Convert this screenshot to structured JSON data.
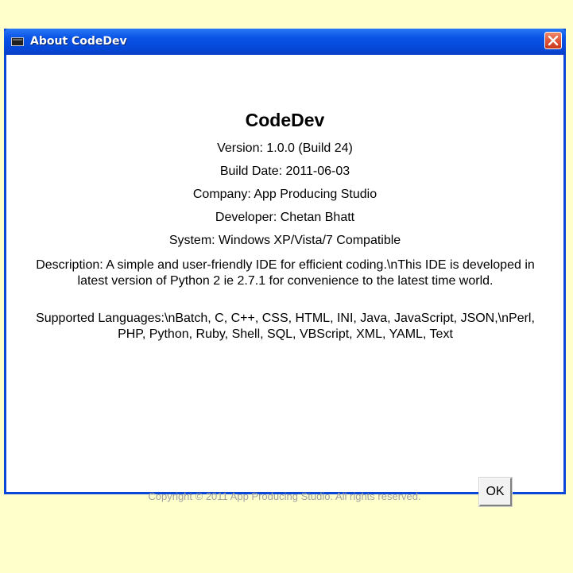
{
  "window": {
    "title": "About CodeDev",
    "icon": "app-window-icon",
    "close_icon": "close-icon"
  },
  "about": {
    "app_name": "CodeDev",
    "version": "Version: 1.0.0 (Build 24)",
    "build_date": "Build Date: 2011-06-03",
    "company": "Company: App Producing Studio",
    "developer": "Developer: Chetan Bhatt",
    "system": "System: Windows XP/Vista/7 Compatible",
    "description": "Description: A simple and user-friendly IDE for efficient coding.\\nThis IDE is developed in latest version of Python 2 ie 2.7.1 for convenience to the latest time world.",
    "languages": "Supported Languages:\\nBatch, C, C++, CSS, HTML, INI, Java, JavaScript, JSON,\\nPerl, PHP, Python, Ruby, Shell, SQL, VBScript, XML, YAML, Text",
    "copyright": "Copyright © 2011 App Producing Studio. All rights reserved.",
    "ok_label": "OK"
  },
  "colors": {
    "background": "#ffffcc",
    "titlebar": "#0a54e6",
    "close_button": "#e0563a",
    "copyright_text": "#a0a0a0"
  }
}
